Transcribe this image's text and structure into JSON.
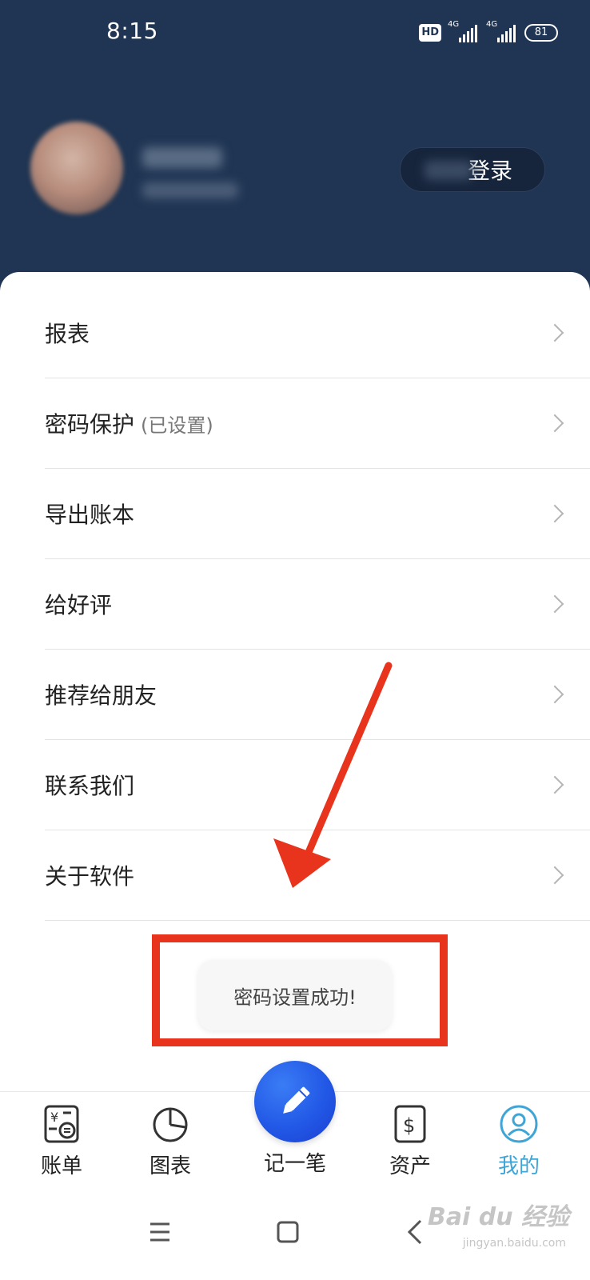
{
  "status_bar": {
    "time": "8:15",
    "hd_badge": "HD",
    "network_1": "4G",
    "network_2": "4G",
    "battery": "81"
  },
  "header": {
    "login_label": "登录"
  },
  "menu": {
    "items": [
      {
        "label": "报表",
        "note": ""
      },
      {
        "label": "密码保护",
        "note": "(已设置)"
      },
      {
        "label": "导出账本",
        "note": ""
      },
      {
        "label": "给好评",
        "note": ""
      },
      {
        "label": "推荐给朋友",
        "note": ""
      },
      {
        "label": "联系我们",
        "note": ""
      },
      {
        "label": "关于软件",
        "note": ""
      }
    ]
  },
  "toast": {
    "message": "密码设置成功!"
  },
  "tabbar": {
    "tabs": [
      {
        "label": "账单",
        "icon": "bill-icon"
      },
      {
        "label": "图表",
        "icon": "pie-chart-icon"
      },
      {
        "label": "记一笔",
        "icon": "pencil-icon"
      },
      {
        "label": "资产",
        "icon": "dollar-icon"
      },
      {
        "label": "我的",
        "icon": "user-icon",
        "active": true
      }
    ]
  },
  "watermark": {
    "text": "Bai du 经验",
    "sub": "jingyan.baidu.com"
  },
  "colors": {
    "header_bg": "#1f3553",
    "active_tab": "#3ea5d6",
    "annotation": "#e8341c",
    "fab": "#2258e6"
  }
}
